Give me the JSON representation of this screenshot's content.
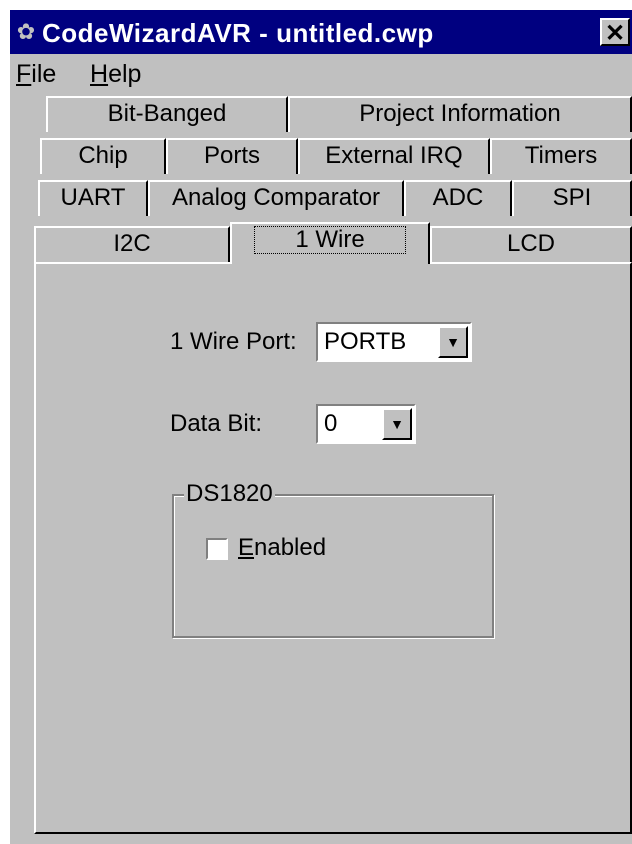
{
  "window": {
    "title": "CodeWizardAVR - untitled.cwp",
    "app_icon": "gear-icon",
    "close_glyph": "✕"
  },
  "menu": [
    {
      "accel": "F",
      "rest": "ile"
    },
    {
      "accel": "H",
      "rest": "elp"
    }
  ],
  "tabs": {
    "row1": [
      "Bit-Banged",
      "Project Information"
    ],
    "row2": [
      "Chip",
      "Ports",
      "External IRQ",
      "Timers"
    ],
    "row3": [
      "UART",
      "Analog Comparator",
      "ADC",
      "SPI"
    ],
    "row4": [
      "I2C",
      "1 Wire",
      "LCD"
    ],
    "active": "1 Wire"
  },
  "one_wire": {
    "port_label": "1 Wire Port:",
    "port_value": "PORTB",
    "bit_label": "Data Bit:",
    "bit_value": "0",
    "dropdown_glyph": "▼"
  },
  "ds1820": {
    "group_title": "DS1820",
    "checkbox_accel": "E",
    "checkbox_rest": "nabled",
    "checked": false
  }
}
